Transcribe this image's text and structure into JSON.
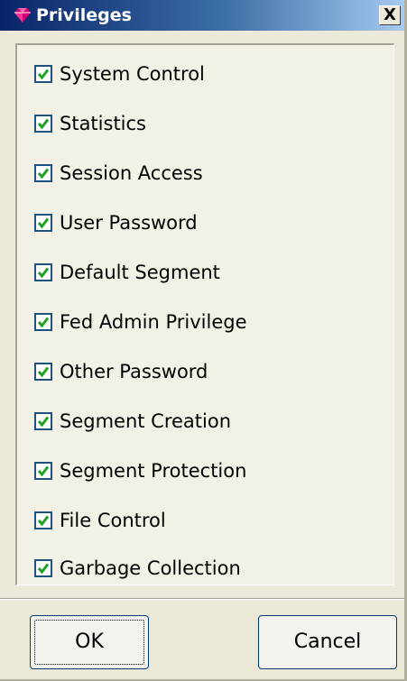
{
  "window": {
    "title": "Privileges",
    "title_icon": "gem-icon",
    "close_label": "X"
  },
  "privileges": [
    {
      "label": "System Control",
      "checked": true
    },
    {
      "label": "Statistics",
      "checked": true
    },
    {
      "label": "Session Access",
      "checked": true
    },
    {
      "label": "User Password",
      "checked": true
    },
    {
      "label": "Default Segment",
      "checked": true
    },
    {
      "label": "Fed Admin Privilege",
      "checked": true
    },
    {
      "label": "Other Password",
      "checked": true
    },
    {
      "label": "Segment Creation",
      "checked": true
    },
    {
      "label": "Segment Protection",
      "checked": true
    },
    {
      "label": "File Control",
      "checked": true
    },
    {
      "label": "Garbage Collection",
      "checked": true
    }
  ],
  "buttons": {
    "ok_label": "OK",
    "cancel_label": "Cancel"
  },
  "colors": {
    "checkmark": "#21a121",
    "checkbox_border": "#1c5180",
    "title_gem": "#d6006f"
  }
}
